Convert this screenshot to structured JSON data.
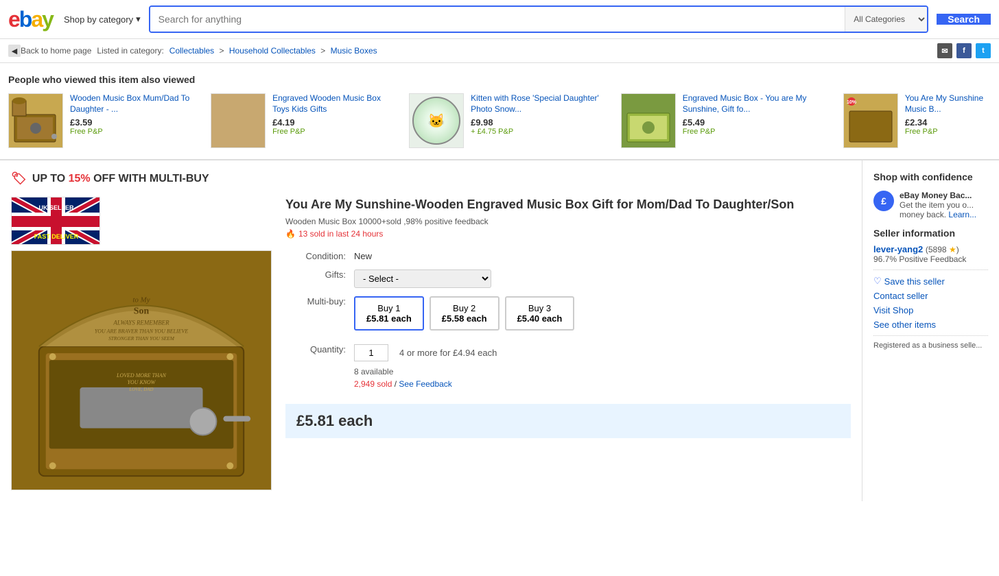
{
  "header": {
    "logo_letters": [
      "e",
      "b",
      "a",
      "y"
    ],
    "shop_by_category": "Shop by category",
    "search_placeholder": "Search for anything",
    "search_category": "All Categories",
    "search_btn": "Search"
  },
  "breadcrumb": {
    "back_text": "Back to home page",
    "listed_in": "Listed in category:",
    "categories": [
      "Collectables",
      "Household Collectables",
      "Music Boxes"
    ]
  },
  "also_viewed": {
    "title": "People who viewed this item also viewed",
    "items": [
      {
        "title": "Wooden Music Box Mum/Dad To Daughter - ...",
        "price": "£3.59",
        "shipping": "Free P&P"
      },
      {
        "title": "Engraved Wooden Music Box Toys Kids Gifts",
        "price": "£4.19",
        "shipping": "Free P&P"
      },
      {
        "title": "Kitten with Rose 'Special Daughter' Photo Snow...",
        "price": "£9.98",
        "shipping": "+ £4.75 P&P"
      },
      {
        "title": "Engraved Music Box - You are My Sunshine, Gift fo...",
        "price": "£5.49",
        "shipping": "Free P&P"
      },
      {
        "title": "You Are My Sunshine Music B...",
        "price": "£2.34",
        "shipping": "Free P&P"
      }
    ]
  },
  "multibuy_banner": "UP TO 15% OFF WITH MULTI-BUY",
  "product": {
    "title": "You Are My Sunshine-Wooden Engraved Music Box Gift for Mom/Dad To Daughter/Son",
    "subtitle": "Wooden Music Box 10000+sold ,98% positive feedback",
    "sold_count": "13 sold in last 24 hours",
    "condition_label": "Condition:",
    "condition_value": "New",
    "gifts_label": "Gifts:",
    "gifts_placeholder": "- Select -",
    "multibuy_label": "Multi-buy:",
    "multibuy_options": [
      {
        "label": "Buy 1",
        "price": "£5.81 each",
        "selected": true
      },
      {
        "label": "Buy 2",
        "price": "£5.58 each",
        "selected": false
      },
      {
        "label": "Buy 3",
        "price": "£5.40 each",
        "selected": false
      }
    ],
    "quantity_label": "Quantity:",
    "quantity_value": "1",
    "more_for": "4 or more for £4.94 each",
    "available": "8 available",
    "sold_feedback": "2,949 sold",
    "feedback_link": "See Feedback",
    "main_price": "£5.81 each"
  },
  "sidebar": {
    "confidence_title": "Shop with confidence",
    "money_back_title": "eBay Money Bac...",
    "money_back_text": "Get the item you o... money back.",
    "learn_more": "Learn...",
    "seller_info_title": "Seller information",
    "seller_name": "lever-yang2",
    "seller_score": "(5898",
    "positive_feedback": "96.7% Positive Feedback",
    "save_seller": "Save this seller",
    "contact_seller": "Contact seller",
    "visit_shop": "Visit Shop",
    "see_other_items": "See other items",
    "registered_text": "Registered as a business selle..."
  }
}
